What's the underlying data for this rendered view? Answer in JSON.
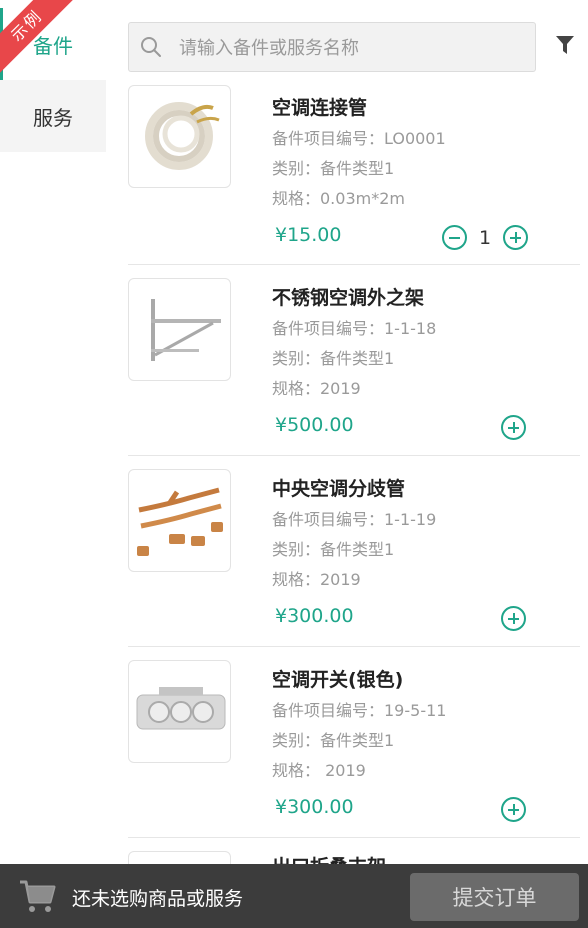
{
  "ribbon": {
    "label": "示例",
    "color": "#e8474a"
  },
  "categories": [
    {
      "label": "备件",
      "active": true
    },
    {
      "label": "服务",
      "active": false
    }
  ],
  "search": {
    "placeholder": "请输入备件或服务名称",
    "icon": "search-icon"
  },
  "filter": {
    "icon": "filter-icon"
  },
  "accent_color": "#1fa58a",
  "items": [
    {
      "name": "空调连接管",
      "code": "备件项目编号：LO0001",
      "category": "类别：备件类型1",
      "spec": "规格：0.03m*2m",
      "price": "¥15.00",
      "quantity": "1"
    },
    {
      "name": "不锈钢空调外之架",
      "code": "备件项目编号：1-1-18",
      "category": "类别：备件类型1",
      "spec": "规格：2019",
      "price": "¥500.00"
    },
    {
      "name": "中央空调分歧管",
      "code": "备件项目编号：1-1-19",
      "category": "类别：备件类型1",
      "spec": "规格：2019",
      "price": "¥300.00"
    },
    {
      "name": "空调开关(银色)",
      "code": "备件项目编号：19-5-11",
      "category": "类别：备件类型1",
      "spec": "规格： 2019",
      "price": "¥300.00"
    },
    {
      "name": "出口折叠支架"
    }
  ],
  "bottom": {
    "status": "还未选购商品或服务",
    "submit_label": "提交订单",
    "cart_icon": "cart-icon"
  }
}
